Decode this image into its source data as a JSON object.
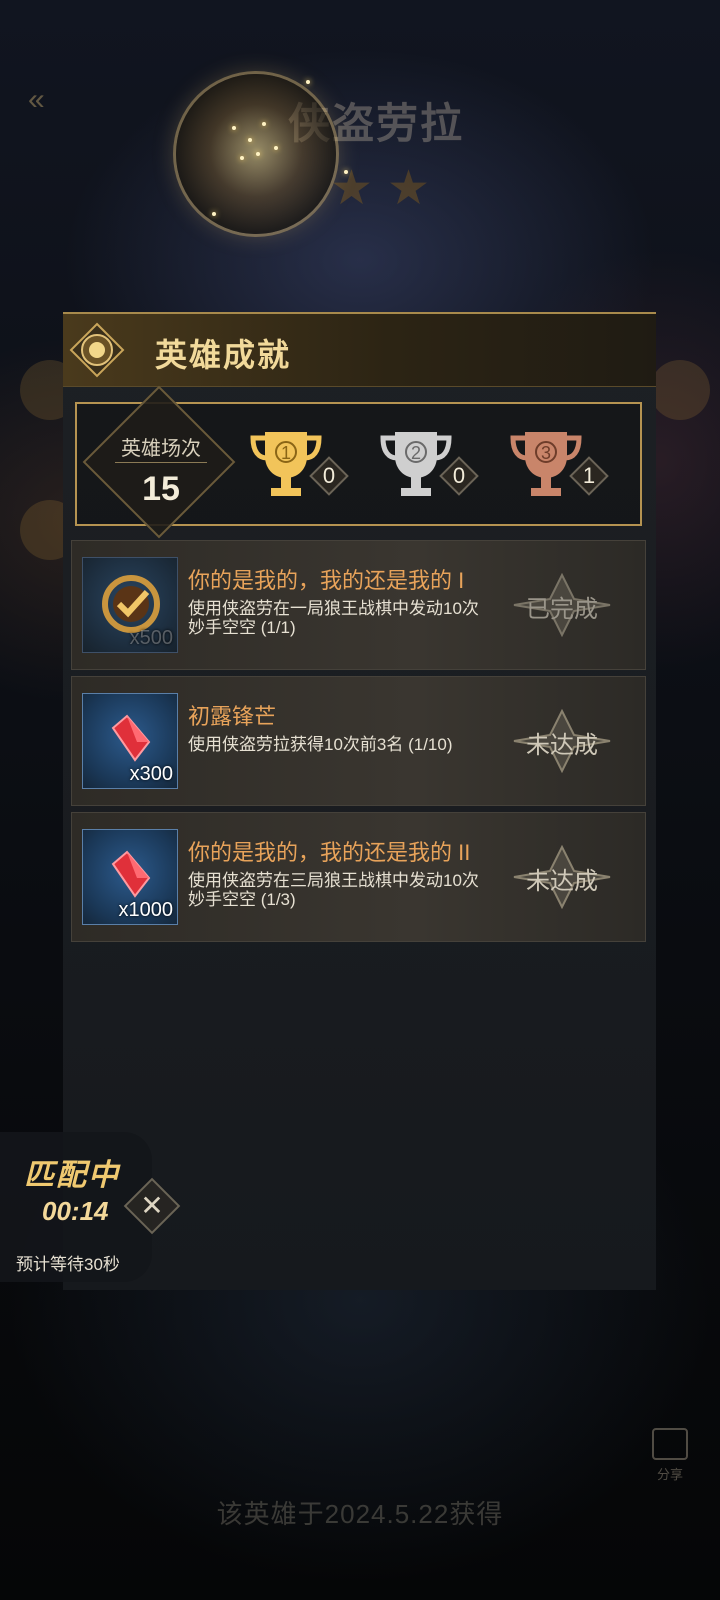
{
  "background": {
    "back_icon": "«",
    "hero_name": "侠盗劳拉",
    "footer_text": "该英雄于2024.5.22获得",
    "share_label": "分享"
  },
  "panel": {
    "title": "英雄成就",
    "games_label": "英雄场次",
    "games_value": "15",
    "trophies": [
      {
        "rank": "1",
        "count": "0",
        "color": "#f2c45a"
      },
      {
        "rank": "2",
        "count": "0",
        "color": "#cfcfcf"
      },
      {
        "rank": "3",
        "count": "1",
        "color": "#c9856a"
      }
    ]
  },
  "achievements": [
    {
      "title": "你的是我的，我的还是我的 I",
      "description": "使用侠盗劳在一局狼王战棋中发动10次妙手空空 (1/1)",
      "reward_qty": "x500",
      "reward_icon": "check-medal-icon",
      "status": "已完成"
    },
    {
      "title": "初露锋芒",
      "description": "使用侠盗劳拉获得10次前3名 (1/10)",
      "reward_qty": "x300",
      "reward_icon": "red-gem-icon",
      "status": "未达成"
    },
    {
      "title": "你的是我的，我的还是我的 II",
      "description": "使用侠盗劳在三局狼王战棋中发动10次妙手空空 (1/3)",
      "reward_qty": "x1000",
      "reward_icon": "red-gem-icon",
      "status": "未达成"
    }
  ],
  "matching": {
    "title": "匹配中",
    "time": "00:14",
    "estimate": "预计等待30秒",
    "cancel_icon": "✕"
  }
}
